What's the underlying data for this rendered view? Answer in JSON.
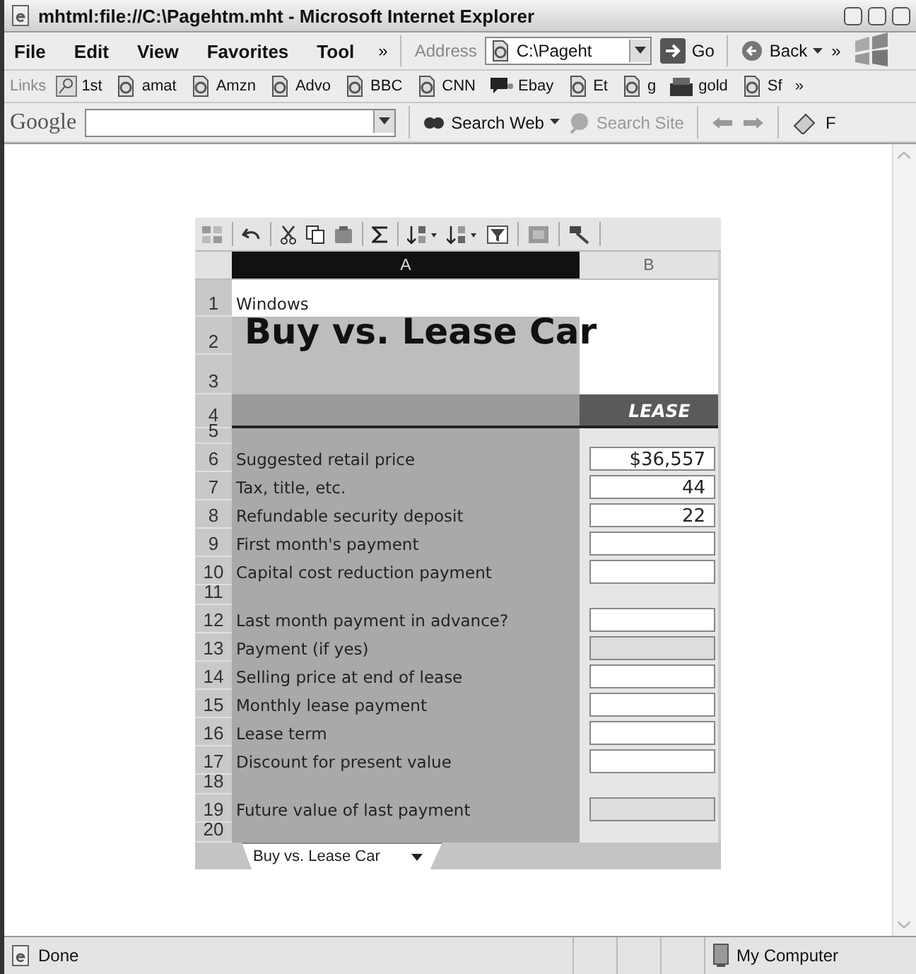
{
  "window": {
    "title": "mhtml:file://C:\\Pagehtm.mht - Microsoft Internet Explorer"
  },
  "menu": [
    "File",
    "Edit",
    "View",
    "Favorites",
    "Tool"
  ],
  "menu_more": "»",
  "address": {
    "label": "Address",
    "value": "C:\\Pageht",
    "go": "Go",
    "back": "Back",
    "more": "»"
  },
  "links": {
    "label": "Links",
    "more": "»",
    "items": [
      {
        "label": "1st",
        "kind": "key"
      },
      {
        "label": "amat",
        "kind": "page"
      },
      {
        "label": "Amzn",
        "kind": "page"
      },
      {
        "label": "Advo",
        "kind": "page"
      },
      {
        "label": "BBC",
        "kind": "page"
      },
      {
        "label": "CNN",
        "kind": "page"
      },
      {
        "label": "Ebay",
        "kind": "chat"
      },
      {
        "label": "Et",
        "kind": "page"
      },
      {
        "label": "g",
        "kind": "page"
      },
      {
        "label": "gold",
        "kind": "store"
      },
      {
        "label": "Sf",
        "kind": "page"
      }
    ]
  },
  "google": {
    "logo": "Google",
    "search_web": "Search Web",
    "search_site": "Search Site",
    "more": "F"
  },
  "sheet": {
    "columns": [
      {
        "label": "A",
        "selected": true
      },
      {
        "label": "B",
        "selected": false
      }
    ],
    "rows": [
      {
        "number": "1",
        "kind": "caption",
        "label": "Windows"
      },
      {
        "number": "2",
        "kind": "title",
        "label": "Buy vs. Lease Car"
      },
      {
        "number": "3",
        "kind": "blank"
      },
      {
        "number": "4",
        "kind": "header",
        "value": "LEASE"
      },
      {
        "number": "5",
        "kind": "gap"
      },
      {
        "number": "6",
        "kind": "input",
        "label": "Suggested retail price",
        "value": "$36,557"
      },
      {
        "number": "7",
        "kind": "input",
        "label": "Tax, title, etc.",
        "value": "44"
      },
      {
        "number": "8",
        "kind": "input",
        "label": "Refundable security deposit",
        "value": "22"
      },
      {
        "number": "9",
        "kind": "input",
        "label": "First month's payment"
      },
      {
        "number": "10",
        "kind": "input",
        "label": "Capital cost reduction payment"
      },
      {
        "number": "11",
        "kind": "gap"
      },
      {
        "number": "12",
        "kind": "input",
        "label": "Last month payment in advance?"
      },
      {
        "number": "13",
        "kind": "computed",
        "label": "Payment (if yes)"
      },
      {
        "number": "14",
        "kind": "input",
        "label": "Selling price at end of lease"
      },
      {
        "number": "15",
        "kind": "input",
        "label": "Monthly lease payment"
      },
      {
        "number": "16",
        "kind": "input",
        "label": "Lease term"
      },
      {
        "number": "17",
        "kind": "input",
        "label": "Discount for present value"
      },
      {
        "number": "18",
        "kind": "gap"
      },
      {
        "number": "19",
        "kind": "computed",
        "label": "Future value of last payment"
      },
      {
        "number": "20",
        "kind": "gap"
      }
    ],
    "tabs": [
      {
        "label": "Buy vs. Lease Car",
        "selected": true
      }
    ]
  },
  "status_bar": {
    "text": "Done",
    "zone": "My Computer"
  }
}
